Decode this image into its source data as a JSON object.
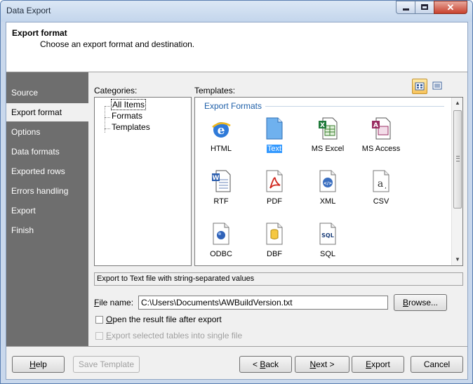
{
  "window": {
    "title": "Data Export"
  },
  "header": {
    "title": "Export format",
    "subtitle": "Choose an export format and destination."
  },
  "sidebar": {
    "items": [
      {
        "label": "Source"
      },
      {
        "label": "Export format",
        "active": true
      },
      {
        "label": "Options"
      },
      {
        "label": "Data formats"
      },
      {
        "label": "Exported rows"
      },
      {
        "label": "Errors handling"
      },
      {
        "label": "Export"
      },
      {
        "label": "Finish"
      }
    ]
  },
  "categories": {
    "label": "Categories:",
    "items": [
      {
        "label": "All Items",
        "selected": true
      },
      {
        "label": "Formats"
      },
      {
        "label": "Templates"
      }
    ]
  },
  "templates": {
    "label": "Templates:",
    "group_title": "Export Formats",
    "items": [
      {
        "label": "HTML",
        "icon": "html-icon"
      },
      {
        "label": "Text",
        "icon": "text-file-icon",
        "selected": true
      },
      {
        "label": "MS Excel",
        "icon": "excel-icon"
      },
      {
        "label": "MS Access",
        "icon": "access-icon"
      },
      {
        "label": "RTF",
        "icon": "rtf-icon"
      },
      {
        "label": "PDF",
        "icon": "pdf-icon"
      },
      {
        "label": "XML",
        "icon": "xml-icon"
      },
      {
        "label": "CSV",
        "icon": "csv-icon"
      },
      {
        "label": "ODBC",
        "icon": "odbc-icon"
      },
      {
        "label": "DBF",
        "icon": "dbf-icon"
      },
      {
        "label": "SQL",
        "icon": "sql-icon"
      }
    ]
  },
  "description": "Export to Text file with string-separated values",
  "file": {
    "label_key": "F",
    "label_rest": "ile name:",
    "value": "C:\\Users\\Documents\\AWBuildVersion.txt",
    "browse_key": "B",
    "browse_rest": "rowse..."
  },
  "options": {
    "open_after_key": "O",
    "open_after_rest": "pen the result file after export",
    "single_file_key": "E",
    "single_file_rest": "xport selected tables into single file"
  },
  "buttons": {
    "help_key": "H",
    "help_rest": "elp",
    "save_template": "Save Template",
    "back_prefix": "< ",
    "back_key": "B",
    "back_rest": "ack",
    "next_key": "N",
    "next_rest": "ext >",
    "export_key": "E",
    "export_rest": "xport",
    "cancel": "Cancel"
  },
  "colors": {
    "sidebar": "#6e6e6e",
    "accent": "#1e5fa8",
    "selection": "#3399ff"
  }
}
